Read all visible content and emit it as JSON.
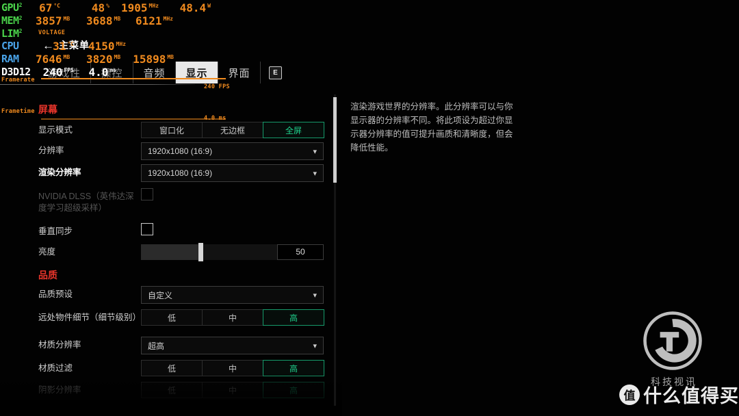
{
  "menu": {
    "tabs": [
      {
        "id": "gameplay",
        "label": "游戏性",
        "state": "obscured"
      },
      {
        "id": "controls",
        "label": "操控",
        "state": "obscured"
      },
      {
        "id": "audio",
        "label": "音频",
        "state": "normal"
      },
      {
        "id": "display",
        "label": "显示",
        "state": "active"
      },
      {
        "id": "interface",
        "label": "界面",
        "state": "normal"
      }
    ],
    "key_badge": "E",
    "back_nav": {
      "arrow": "←",
      "label": "主菜单"
    },
    "sections": [
      {
        "id": "screen",
        "title": "屏幕",
        "rows": [
          {
            "id": "display-mode",
            "label": "显示模式",
            "type": "segmented",
            "options": [
              "窗口化",
              "无边框",
              "全屏"
            ],
            "selected": 2
          },
          {
            "id": "resolution",
            "label": "分辨率",
            "type": "select",
            "value": "1920x1080 (16:9)"
          },
          {
            "id": "render-resolution",
            "label": "渲染分辨率",
            "type": "select",
            "value": "1920x1080 (16:9)",
            "highlight": true
          },
          {
            "id": "nvidia-dlss",
            "label": "NVIDIA DLSS（英伟达深度学习超级采样）",
            "type": "checkbox",
            "checked": false,
            "disabled": true
          },
          {
            "id": "vsync",
            "label": "垂直同步",
            "type": "checkbox",
            "checked": false
          },
          {
            "id": "brightness",
            "label": "亮度",
            "type": "slider",
            "value": "50",
            "percent": 42
          }
        ]
      },
      {
        "id": "quality",
        "title": "品质",
        "rows": [
          {
            "id": "quality-preset",
            "label": "品质预设",
            "type": "select",
            "value": "自定义"
          },
          {
            "id": "object-detail",
            "label": "远处物件细节（细节级别）",
            "type": "segmented",
            "options": [
              "低",
              "中",
              "高"
            ],
            "selected": 2
          },
          {
            "id": "texture-resolution",
            "label": "材质分辨率",
            "type": "select",
            "value": "超高"
          },
          {
            "id": "texture-filtering",
            "label": "材质过滤",
            "type": "segmented",
            "options": [
              "低",
              "中",
              "高"
            ],
            "selected": 2
          },
          {
            "id": "shadow-resolution",
            "label": "阴影分辨率",
            "type": "segmented",
            "options": [
              "低",
              "中",
              "高"
            ],
            "selected": 2,
            "faded": true
          }
        ]
      }
    ],
    "description": "渲染游戏世界的分辨率。此分辨率可以与你显示器的分辨率不同。将此项设为超过你显示器分辨率的值可提升画质和清晰度，但会降低性能。"
  },
  "osd": {
    "rows": [
      {
        "key": "GPU",
        "sub": "2",
        "color": "green",
        "values": [
          {
            "v": "67",
            "u": "°C"
          },
          {
            "v": "48",
            "u": "%"
          },
          {
            "v": "1905",
            "u": "MHz"
          },
          {
            "v": "48.4",
            "u": "W"
          }
        ]
      },
      {
        "key": "MEM",
        "sub": "2",
        "color": "green",
        "values": [
          {
            "v": "3857",
            "u": "MB"
          },
          {
            "v": "3688",
            "u": "MB"
          },
          {
            "v": "6121",
            "u": "MHz"
          }
        ]
      },
      {
        "key": "LIM",
        "sub": "2",
        "color": "green",
        "note": "VOLTAGE",
        "values": []
      },
      {
        "key": "CPU",
        "sub": "",
        "color": "blue",
        "values": [
          {
            "v": "31",
            "u": "°C"
          },
          {
            "v": "4150",
            "u": "MHz"
          }
        ]
      },
      {
        "key": "RAM",
        "sub": "",
        "color": "blue",
        "values": [
          {
            "v": "7646",
            "u": "MB"
          },
          {
            "v": "3820",
            "u": "MB"
          },
          {
            "v": "15898",
            "u": "MB"
          }
        ]
      },
      {
        "key": "D3D12",
        "sub": "",
        "color": "white",
        "values": [
          {
            "v": "240",
            "u": "FPS"
          },
          {
            "v": "4.0",
            "u": "ms"
          }
        ]
      }
    ],
    "graphs": [
      {
        "id": "framerate",
        "label": "Framerate",
        "scale": "240 FPS"
      },
      {
        "id": "frametime",
        "label": "Frametime",
        "scale": "4.0 ms"
      }
    ]
  },
  "watermarks": {
    "tech": {
      "logo": "TV",
      "text": "科技视讯"
    },
    "smzdm": {
      "badge": "值",
      "text": "什么值得买"
    }
  }
}
